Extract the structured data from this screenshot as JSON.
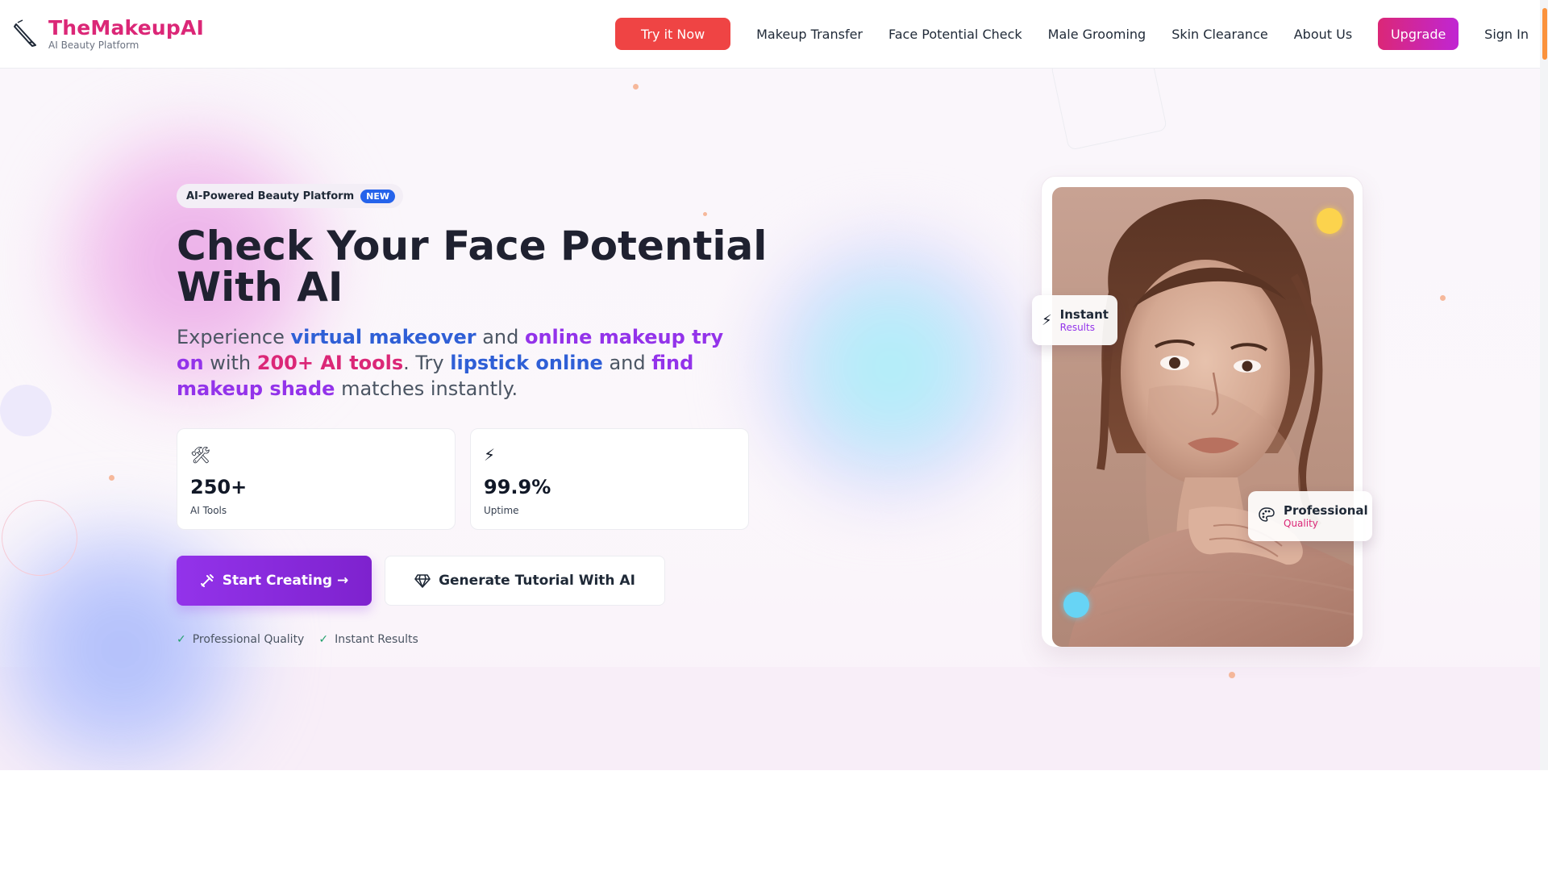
{
  "brand": {
    "title": "TheMakeupAI",
    "subtitle": "AI Beauty Platform",
    "logo_icon": "pen-brush-icon",
    "colors": {
      "brand_pink": "#db2777",
      "purple": "#9333ea",
      "blue": "#2f5fd6",
      "try_red": "#ef4444"
    }
  },
  "nav": {
    "try_now": "Try it Now",
    "links": [
      "Makeup Transfer",
      "Face Potential Check",
      "Male Grooming",
      "Skin Clearance",
      "About Us"
    ],
    "upgrade": "Upgrade",
    "sign_in": "Sign In"
  },
  "hero": {
    "badge": {
      "label": "AI-Powered Beauty Platform",
      "tag": "NEW"
    },
    "headline": "Check Your Face Potential With AI",
    "subtext": {
      "p1": "Experience ",
      "h1": "virtual makeover",
      "p2": " and ",
      "h2": "online makeup try on",
      "p3": " with ",
      "h3": "200+ AI tools",
      "p4": ". Try ",
      "h4": "lipstick online",
      "p5": " and ",
      "h5": "find makeup shade",
      "p6": " matches instantly."
    },
    "stats": [
      {
        "icon": "tools-icon",
        "glyph": "🛠",
        "value": "250+",
        "label": "AI Tools"
      },
      {
        "icon": "lightning-icon",
        "glyph": "⚡",
        "value": "99.9%",
        "label": "Uptime"
      }
    ],
    "cta_primary": "Start Creating →",
    "cta_secondary": "Generate Tutorial With AI",
    "checks": [
      "Professional Quality",
      "Instant Results"
    ]
  },
  "showcase": {
    "instant": {
      "title": "Instant",
      "sub": "Results"
    },
    "professional": {
      "title": "Professional",
      "sub": "Quality"
    }
  }
}
